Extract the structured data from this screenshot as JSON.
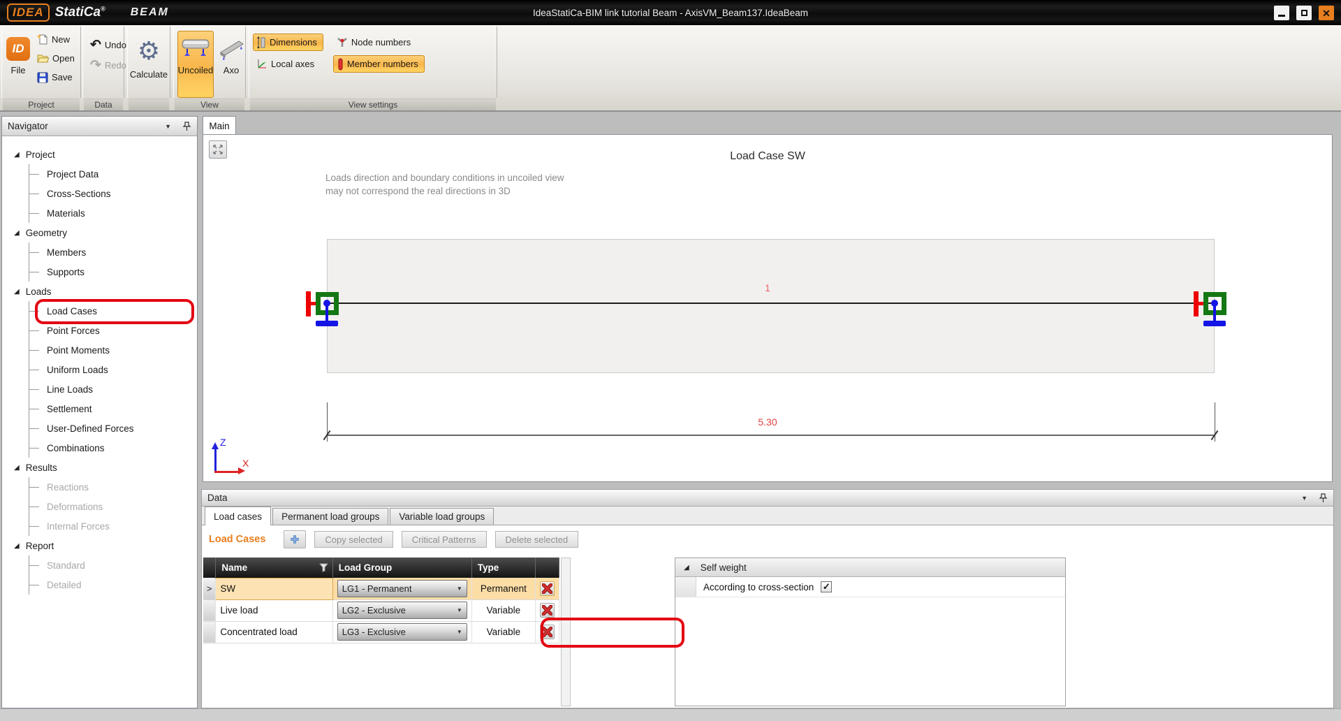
{
  "window": {
    "logo": "IDEA",
    "brand": "StatiCa",
    "registered": "®",
    "product": "BEAM",
    "title": "IdeaStatiCa-BIM link tutorial Beam - AxisVM_Beam137.IdeaBeam"
  },
  "ribbon": {
    "file": "File",
    "new": "New",
    "open": "Open",
    "save": "Save",
    "undo": "Undo",
    "redo": "Redo",
    "calculate": "Calculate",
    "uncoiled": "Uncoiled",
    "axo": "Axo",
    "dimensions": "Dimensions",
    "local_axes": "Local axes",
    "node_numbers": "Node numbers",
    "member_numbers": "Member numbers",
    "group_project": "Project",
    "group_data": "Data",
    "group_view": "View",
    "group_view_settings": "View settings"
  },
  "navigator": {
    "title": "Navigator",
    "tree": [
      {
        "label": "Project"
      },
      {
        "label": "Project Data"
      },
      {
        "label": "Cross-Sections"
      },
      {
        "label": "Materials"
      },
      {
        "label": "Geometry"
      },
      {
        "label": "Members"
      },
      {
        "label": "Supports"
      },
      {
        "label": "Loads"
      },
      {
        "label": "Load Cases",
        "highlighted": true
      },
      {
        "label": "Point Forces"
      },
      {
        "label": "Point Moments"
      },
      {
        "label": "Uniform Loads"
      },
      {
        "label": "Line Loads"
      },
      {
        "label": "Settlement"
      },
      {
        "label": "User-Defined Forces"
      },
      {
        "label": "Combinations"
      },
      {
        "label": "Results"
      },
      {
        "label": "Reactions",
        "disabled": true
      },
      {
        "label": "Deformations",
        "disabled": true
      },
      {
        "label": "Internal Forces",
        "disabled": true
      },
      {
        "label": "Report"
      },
      {
        "label": "Standard",
        "disabled": true
      },
      {
        "label": "Detailed",
        "disabled": true
      }
    ]
  },
  "main": {
    "tab": "Main",
    "view_title": "Load Case SW",
    "note_line1": "Loads direction and boundary conditions in uncoiled view",
    "note_line2": "may not correspond the real directions in 3D",
    "member_number": "1",
    "dimension_value": "5.30",
    "axis_z": "Z",
    "axis_x": "X"
  },
  "data_panel": {
    "title": "Data",
    "tabs": [
      "Load cases",
      "Permanent load groups",
      "Variable load groups"
    ],
    "active_tab": "Load cases",
    "section_title": "Load Cases",
    "toolbar": {
      "copy_selected": "Copy selected",
      "critical_patterns": "Critical Patterns",
      "delete_selected": "Delete selected"
    },
    "table": {
      "headers": {
        "name": "Name",
        "load_group": "Load Group",
        "type": "Type"
      },
      "rows": [
        {
          "name": "SW",
          "load_group": "LG1 - Permanent",
          "type": "Permanent",
          "selected": true
        },
        {
          "name": "Live load",
          "load_group": "LG2 - Exclusive",
          "type": "Variable",
          "selected": false
        },
        {
          "name": "Concentrated load",
          "load_group": "LG3 - Exclusive",
          "type": "Variable",
          "selected": false,
          "annotated": true
        }
      ]
    },
    "detail": {
      "group_title": "Self weight",
      "option_label": "According to cross-section",
      "option_checked": true
    }
  },
  "colors": {
    "accent_orange": "#e87f1f",
    "toggled_button_orange": "#f8b64a",
    "annotation_red": "#e30613",
    "selected_row": "#fcdda6",
    "dimension_red": "#e04040",
    "member_number_red": "#e86060",
    "support_green": "#147814",
    "support_blue": "#1414e6",
    "axis_z_blue": "#2222dd",
    "axis_x_red": "#dd2222"
  }
}
